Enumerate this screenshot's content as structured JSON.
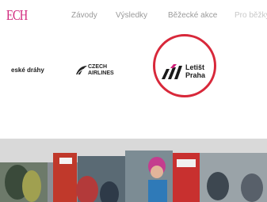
{
  "brand": {
    "text": "ECH"
  },
  "nav": {
    "items": [
      "Závody",
      "Výsledky",
      "Běžecké akce",
      "Pro běžky"
    ]
  },
  "partners": {
    "ceske_drahy": {
      "name": "eské dráhy",
      "sub": ""
    },
    "czech_airlines": {
      "line1": "CZECH",
      "line2": "AIRLINES",
      "extra": ""
    },
    "letiste_praha": {
      "line1": "Letišt",
      "line2": "Praha"
    }
  },
  "colors": {
    "accent": "#d0237a",
    "highlight": "#d8283a"
  },
  "photo": {
    "icon": "runners-photo"
  }
}
